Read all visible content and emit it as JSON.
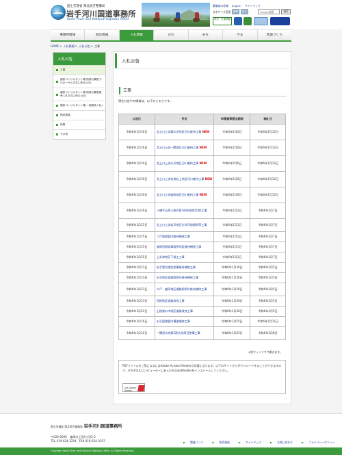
{
  "header": {
    "org_small": "国土交通省 東北地方整備局",
    "title": "岩手河川国道事務所",
    "title_en": "Iwate River and National Highway Office",
    "util_links": [
      "事業者の皆様",
      "English",
      "サイトマップ"
    ],
    "fontsize_label": "文字サイズ変更",
    "fontsize_buttons": [
      "標準",
      "拡大"
    ],
    "search_placeholder": "Google検索",
    "search_button": "検索",
    "bosai_banner": "防災・災害情報"
  },
  "gnav": [
    "事務所情報",
    "防災情報",
    "入札情報",
    "かわ",
    "みち",
    "やま",
    "地域づくり"
  ],
  "breadcrumb": [
    "HOME",
    "入札情報",
    "入札公告",
    "工事"
  ],
  "sidebar": {
    "title": "入札公告",
    "items": [
      "工事",
      "建設コンサルタント等(簡易公募型プロポーザル方式に係る公示)",
      "建設コンサルタント等(簡易公募型競争入札方式に係る公示)",
      "建設コンサルタント等(一般競争入札)",
      "物品調達",
      "役務",
      "その他"
    ]
  },
  "main": {
    "page_title": "入札公告",
    "section_title": "工事",
    "intro": "現在公告中の情報は、以下のとおりです。",
    "columns": [
      "公告日",
      "件名",
      "申請書等提出期限",
      "開札日"
    ],
    "new_label": "NEW",
    "rows": [
      {
        "date": "令和6年1月30日",
        "name": "北上川上流事水沢地区河川維持工事",
        "new": true,
        "deadline": "令和6年2月6日",
        "open": "令和6年3月12日"
      },
      {
        "date": "令和6年1月30日",
        "name": "北上川上流一関地区河川維持工事",
        "new": true,
        "deadline": "令和6年2月6日",
        "open": "令和6年3月12日"
      },
      {
        "date": "令和6年1月30日",
        "name": "北上川上流水沢地区河川維持工事",
        "new": true,
        "deadline": "令和6年2月6日",
        "open": "令和6年3月12日"
      },
      {
        "date": "令和6年1月30日",
        "name": "北上川上流花巻北上地区河川維持工事",
        "new": true,
        "deadline": "令和6年2月6日",
        "open": "令和6年3月12日"
      },
      {
        "date": "令和6年1月30日",
        "name": "北上川上流盛岡地区河川維持工事",
        "new": true,
        "deadline": "令和6年2月6日",
        "open": "令和6年3月12日"
      },
      {
        "date": "令和6年1月26日",
        "name": "八幡平山系小柳沢第1砂防堰堤(1期)工事",
        "new": false,
        "deadline": "令和6年2月2日",
        "open": "令和6年3月7日"
      },
      {
        "date": "令和6年1月25日",
        "name": "北上川上流岩沢地区左岸河道掘削等工事",
        "new": false,
        "deadline": "令和6年2月1日",
        "open": "令和6年3月7日"
      },
      {
        "date": "令和6年1月25日",
        "name": "二戸国道管内維持補修工事",
        "new": false,
        "deadline": "令和6年2月1日",
        "open": "令和6年3月7日"
      },
      {
        "date": "令和6年1月25日",
        "name": "盛岡西国道事務所地区維持補修工事",
        "new": false,
        "deadline": "令和6年2月1日",
        "open": "令和6年3月7日"
      },
      {
        "date": "令和6年1月25日",
        "name": "上米津地区下部工工事",
        "new": false,
        "deadline": "令和6年2月1日",
        "open": "令和6年3月7日"
      },
      {
        "date": "令和6年1月23日",
        "name": "岩手管内通信設備維持補修工事",
        "new": false,
        "deadline": "令和6年1月30日",
        "open": "令和6年3月5日"
      },
      {
        "date": "令和6年1月23日",
        "name": "水沢地区道路照明外維持補修工事",
        "new": false,
        "deadline": "令和6年1月30日",
        "open": "令和6年3月5日"
      },
      {
        "date": "令和6年1月23日",
        "name": "二戸・盛岡地区道路照明外維持補修工事",
        "new": false,
        "deadline": "令和6年1月30日",
        "open": "令和6年3月5日"
      },
      {
        "date": "令和6年1月23日",
        "name": "西根地区道路改良工事",
        "new": false,
        "deadline": "令和6年1月30日",
        "open": "令和6年3月5日"
      },
      {
        "date": "令和6年1月23日",
        "name": "山根架の木地区道路改良工事",
        "new": false,
        "deadline": "令和6年1月30日",
        "open": "令和6年3月5日"
      },
      {
        "date": "令和6年1月16日",
        "name": "水沢国道管内構造補修工事",
        "new": false,
        "deadline": "令和6年1月25日",
        "open": "令和6年3月11日"
      },
      {
        "date": "令和6年1月12日",
        "name": "一関遊水地第2遊水池周辺整備工事",
        "new": false,
        "deadline": "令和6年1月23日",
        "open": "令和6年3月8日"
      }
    ],
    "newwin_note": "※別ウィンドウで開きます。",
    "pdf_text": "PDFファイルをご覧になるにはAdobe Acrobat Readerが必要になります。以下のサイトからダウンロードすることができますので、それぞれのコンピューターにあったAcrobatReaderをインストールしてください。",
    "adobe_badge": "Get Adobe Reader"
  },
  "footer": {
    "org_small": "国土交通省 東北地方整備局",
    "org_big": "岩手河川国道事務所",
    "zip": "〒020-0066　盛岡市上田4丁目2-2",
    "tel": "TEL 019-624-3204　FAX 019-624-3207",
    "links": [
      "関連リンク",
      "免責事項",
      "サイトマップ",
      "お問い合わせ",
      "プライバシーポリシー"
    ],
    "copyright": "Copyright Iwate River and National Highway Office. All Rights Reserved."
  }
}
